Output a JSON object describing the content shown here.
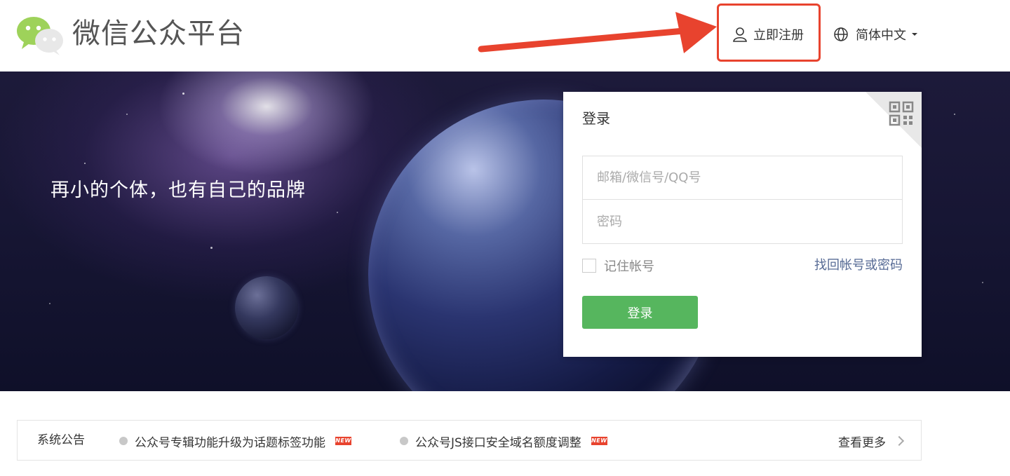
{
  "header": {
    "brand": "微信公众平台",
    "register_label": "立即注册",
    "language_label": "简体中文"
  },
  "banner": {
    "slogan": "再小的个体，也有自己的品牌"
  },
  "login": {
    "title": "登录",
    "account_placeholder": "邮箱/微信号/QQ号",
    "account_value": "",
    "password_placeholder": "密码",
    "password_value": "",
    "remember_label": "记住帐号",
    "remember_checked": false,
    "forgot_label": "找回帐号或密码",
    "submit_label": "登录"
  },
  "notice": {
    "label": "系统公告",
    "items": [
      {
        "text": "公众号专辑功能升级为话题标签功能",
        "badge": "NEW"
      },
      {
        "text": "公众号JS接口安全域名额度调整",
        "badge": "NEW"
      }
    ],
    "more_label": "查看更多"
  },
  "colors": {
    "accent_green": "#56b65e",
    "link_blue": "#576b95",
    "highlight_red": "#e8432e"
  },
  "icons": [
    "wechat-logo-icon",
    "user-icon",
    "globe-icon",
    "chevron-down-icon",
    "qr-code-icon",
    "chevron-right-icon"
  ]
}
